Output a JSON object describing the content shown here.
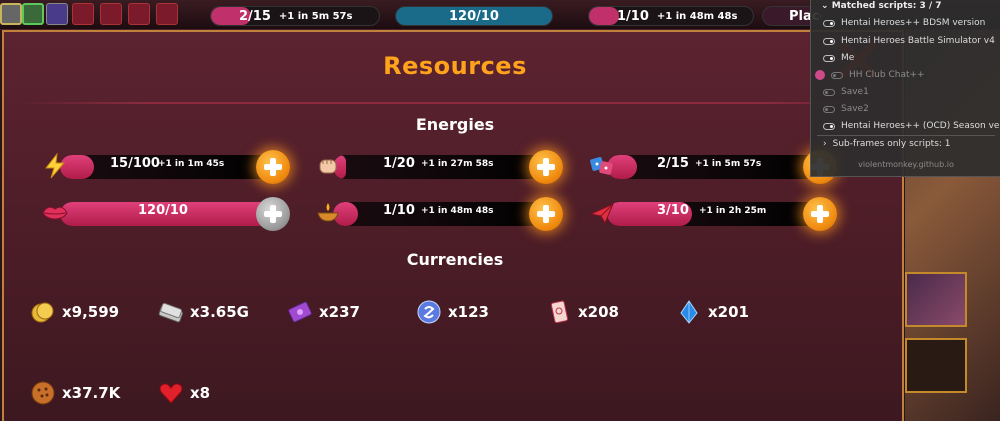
{
  "topbar": {
    "energy_value": "2/15",
    "energy_timer": "+1 in 5m 57s",
    "kiss_value": "120/10",
    "worship_value": "1/10",
    "worship_timer": "+1 in 48m 48s",
    "place_label": "Place"
  },
  "panel": {
    "title": "Resources",
    "energies_title": "Energies",
    "currencies_title": "Currencies"
  },
  "energies": [
    {
      "name": "quest",
      "icon": "lightning-icon",
      "value": "15/100",
      "timer": "+1 in 1m 45s",
      "fill_pct": 15,
      "button": "plus"
    },
    {
      "name": "fight",
      "icon": "fist-icon",
      "value": "1/20",
      "timer": "+1 in 27m 58s",
      "fill_pct": 5,
      "button": "plus"
    },
    {
      "name": "challenge",
      "icon": "dice-icon",
      "value": "2/15",
      "timer": "+1 in 5m 57s",
      "fill_pct": 13,
      "button": "plus"
    },
    {
      "name": "kiss",
      "icon": "lips-icon",
      "value": "120/10",
      "timer": "",
      "fill_pct": 100,
      "button": "plus-disabled"
    },
    {
      "name": "worship",
      "icon": "lamp-icon",
      "value": "1/10",
      "timer": "+1 in 48m 48s",
      "fill_pct": 10,
      "button": "plus"
    },
    {
      "name": "drill",
      "icon": "paper-plane-icon",
      "value": "3/10",
      "timer": "+1 in 2h 25m",
      "fill_pct": 30,
      "button": "plus"
    }
  ],
  "currencies": [
    {
      "name": "ymens",
      "icon": "coins-icon",
      "value": "x9,599"
    },
    {
      "name": "money",
      "icon": "banknotes-icon",
      "value": "x3.65G"
    },
    {
      "name": "tickets",
      "icon": "ticket-icon",
      "value": "x237"
    },
    {
      "name": "koban",
      "icon": "swirl-token-icon",
      "value": "x123"
    },
    {
      "name": "scrolls",
      "icon": "scroll-icon",
      "value": "x208"
    },
    {
      "name": "shards",
      "icon": "crystal-icon",
      "value": "x201"
    },
    {
      "name": "cookies",
      "icon": "cookie-icon",
      "value": "x37.7K"
    },
    {
      "name": "hearts",
      "icon": "heart-icon",
      "value": "x8"
    }
  ],
  "popup": {
    "header": "Matched scripts: 3 / 7",
    "scripts": [
      {
        "label": "Hentai Heroes++ BDSM version",
        "enabled": true
      },
      {
        "label": "Hentai Heroes Battle Simulator v4",
        "enabled": true
      },
      {
        "label": "Me",
        "enabled": true
      },
      {
        "label": "HH Club Chat++",
        "enabled": false
      },
      {
        "label": "Save1",
        "enabled": false
      },
      {
        "label": "Save2",
        "enabled": false
      },
      {
        "label": "Hentai Heroes++ (OCD) Season version",
        "enabled": true
      }
    ],
    "subframes": "Sub-frames only scripts: 1",
    "footer": "violentmonkey.github.io"
  },
  "colors": {
    "accent": "#ffa21c",
    "panel_bg": "#4a1c26",
    "fill": "#d02a5e",
    "plus": "#f5901a"
  }
}
